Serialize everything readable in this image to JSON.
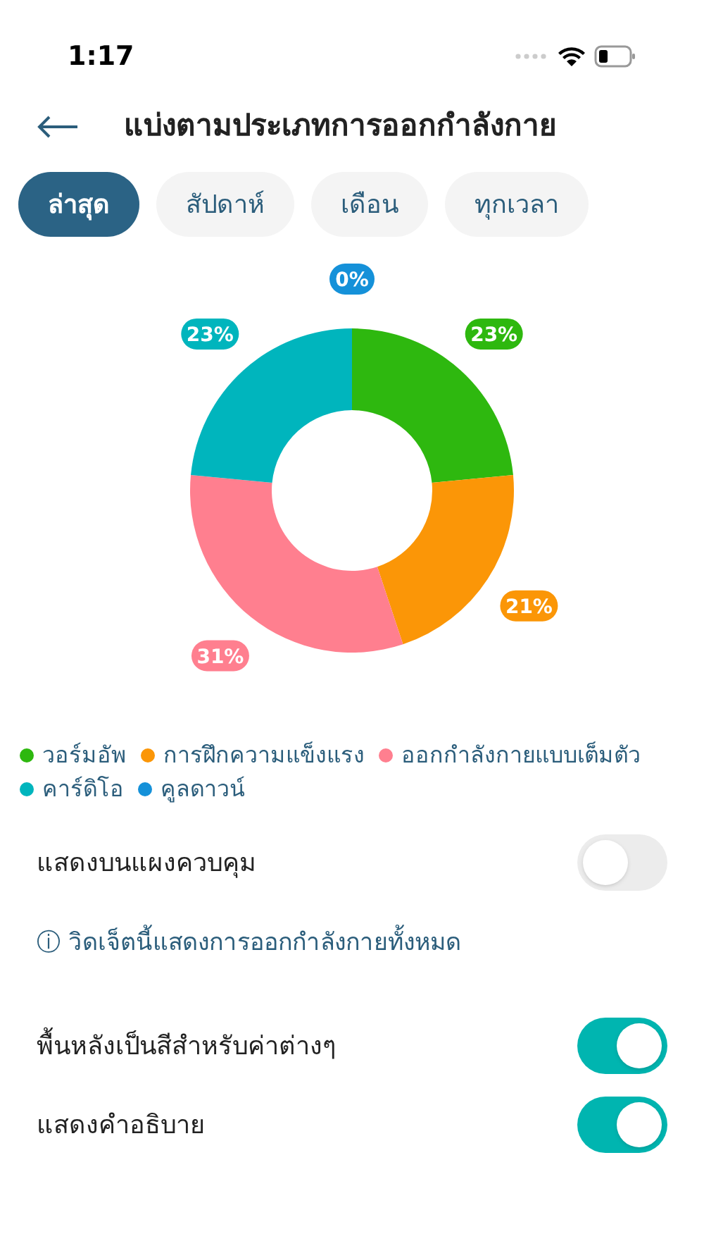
{
  "status_bar": {
    "time": "1:17"
  },
  "header": {
    "title": "แบ่งตามประเภทการออกกำลังกาย"
  },
  "tabs": [
    {
      "label": "ล่าสุด",
      "selected": true
    },
    {
      "label": "สัปดาห์",
      "selected": false
    },
    {
      "label": "เดือน",
      "selected": false
    },
    {
      "label": "ทุกเวลา",
      "selected": false
    }
  ],
  "chart_data": {
    "type": "donut",
    "categories": [
      "วอร์มอัพ",
      "การฝึกความแข็งแรง",
      "ออกกำลังกายแบบเต็มตัว",
      "คาร์ดิโอ",
      "คูลดาวน์"
    ],
    "colors": [
      "#2eb80f",
      "#fb9607",
      "#ff7f8f",
      "#00b5bd",
      "#1591d9"
    ],
    "values": [
      23,
      21,
      31,
      23,
      0
    ],
    "value_labels": [
      "23%",
      "21%",
      "31%",
      "23%",
      "0%"
    ]
  },
  "settings": [
    {
      "kind": "toggle",
      "label": "แสดงบนแผงควบคุม",
      "on": false
    },
    {
      "kind": "info",
      "label": "ⓘ วิดเจ็ตนี้แสดงการออกกำลังกายทั้งหมด"
    },
    {
      "kind": "toggle",
      "label": "พื้นหลังเป็นสีสำหรับค่าต่างๆ",
      "on": true
    },
    {
      "kind": "toggle",
      "label": "แสดงคำอธิบาย",
      "on": true
    }
  ]
}
